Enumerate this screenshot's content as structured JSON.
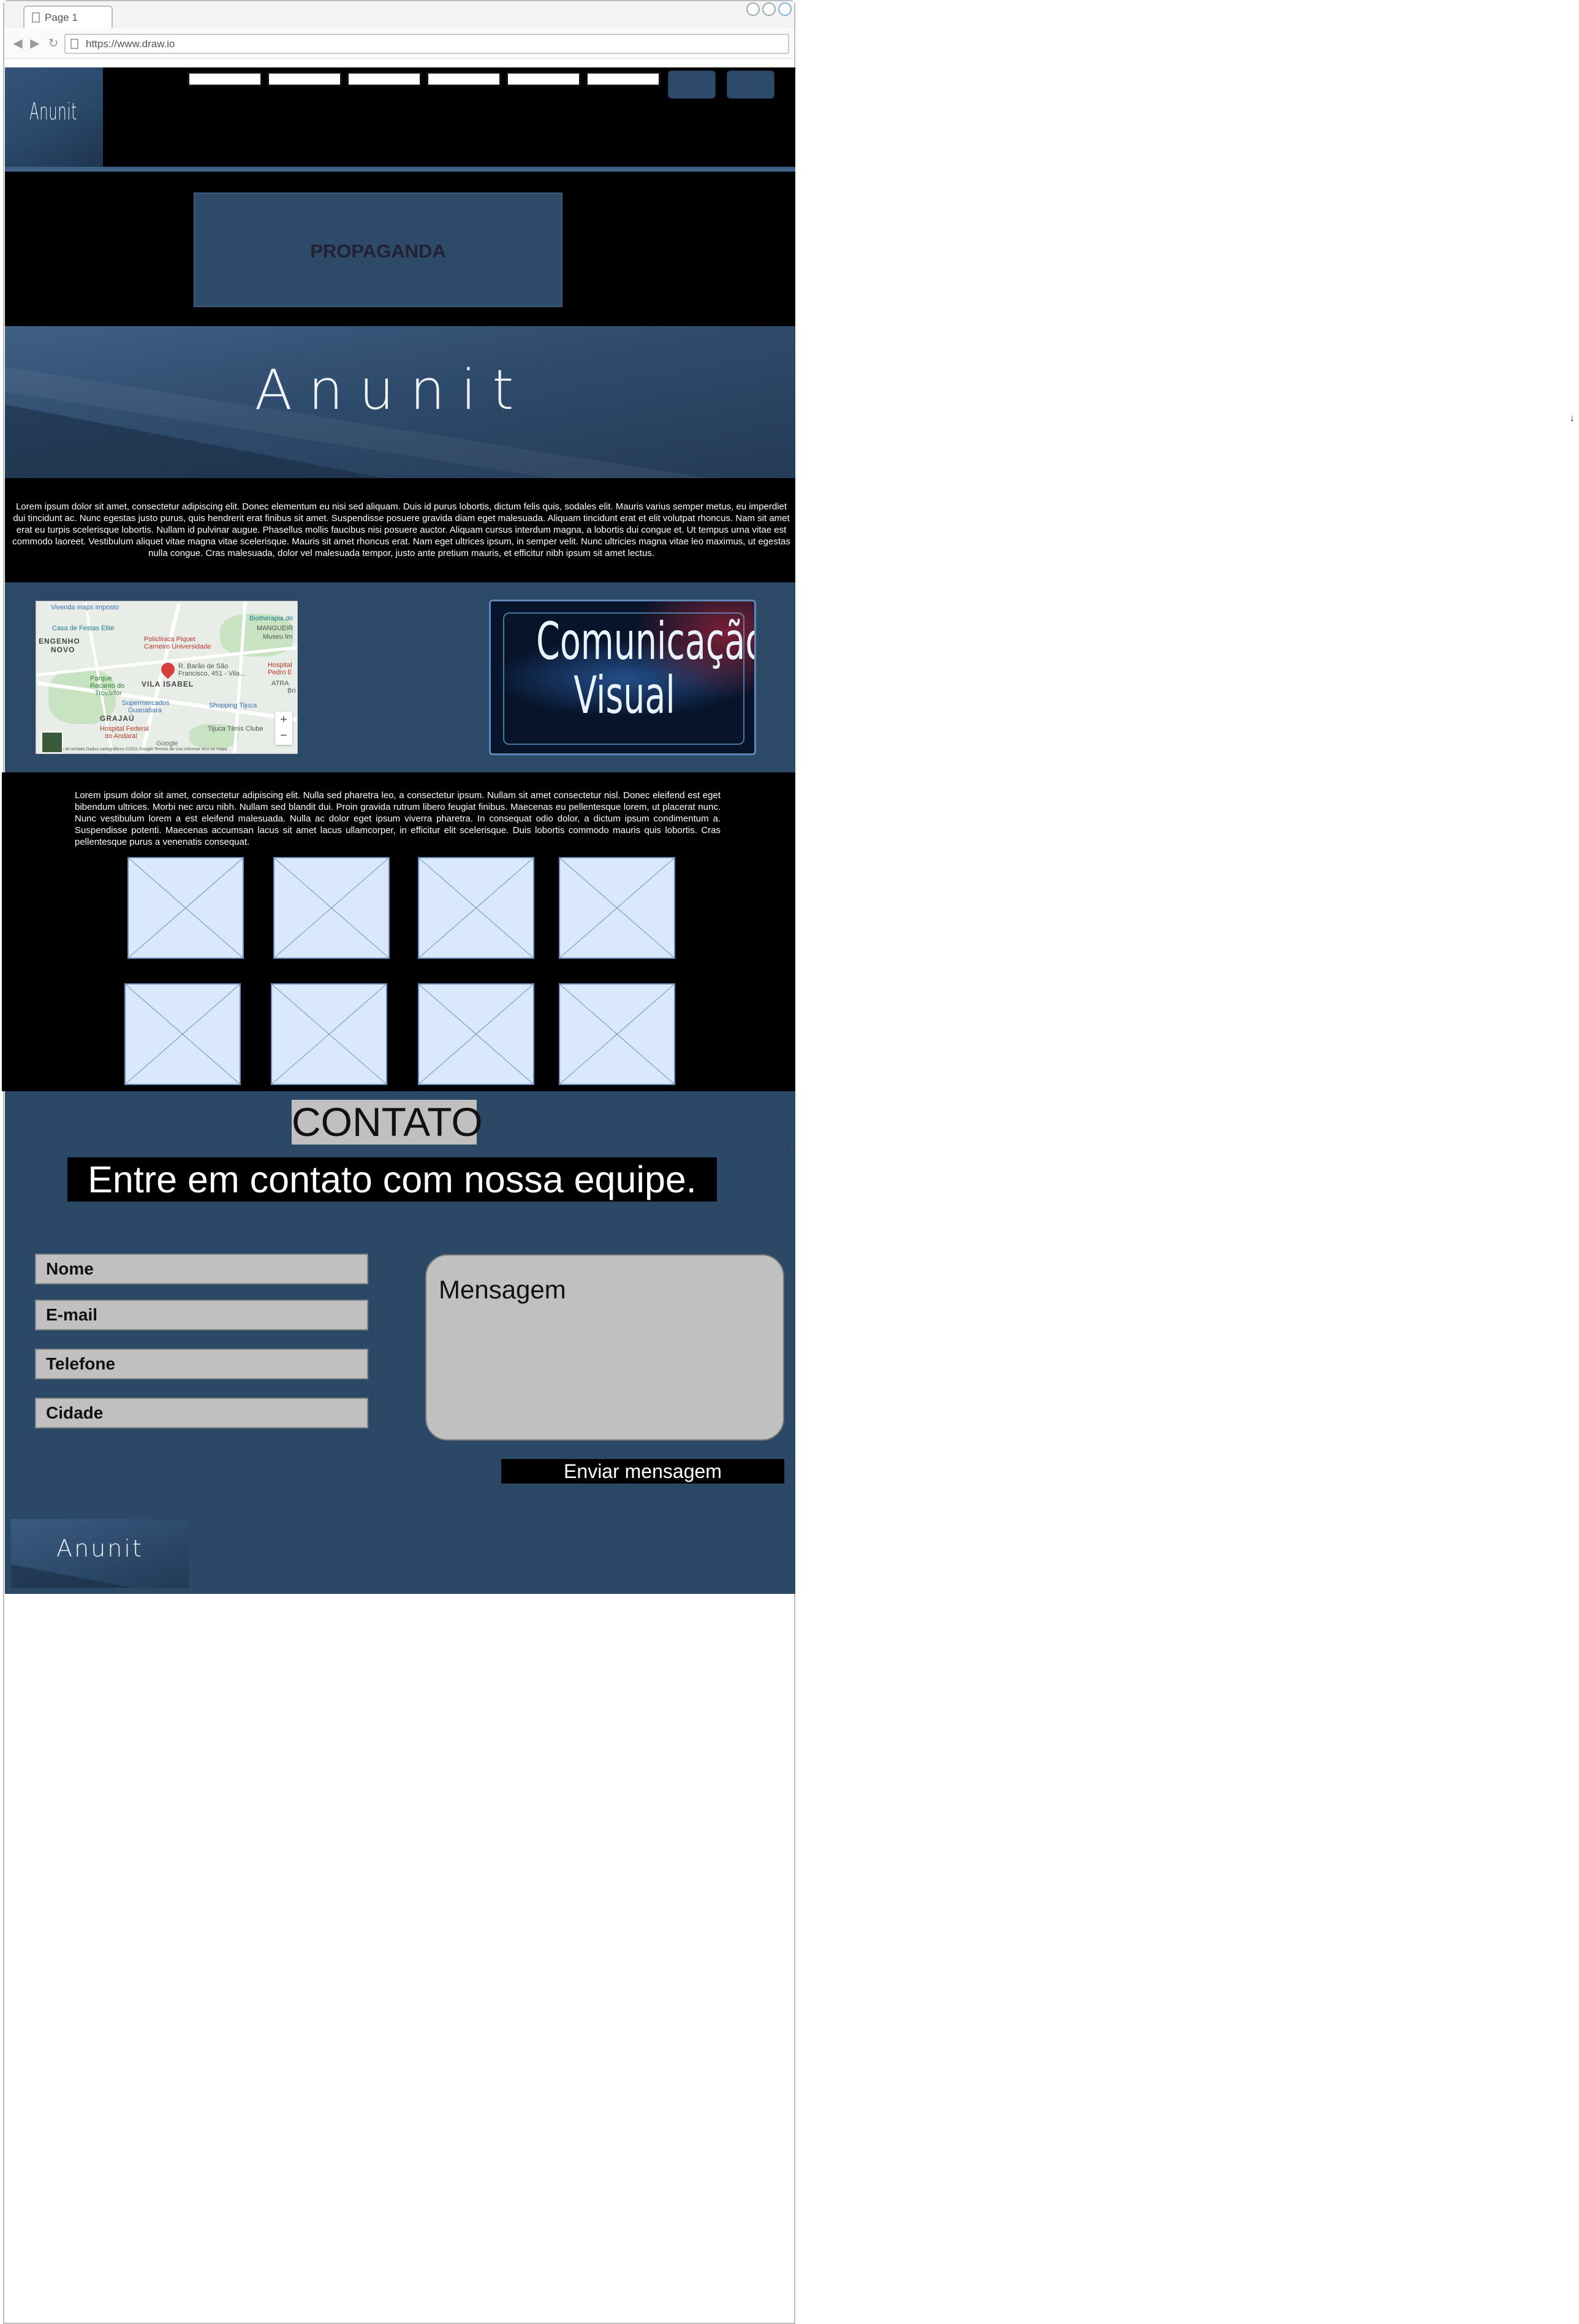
{
  "browser": {
    "tab_label": "Page 1",
    "url": "https://www.draw.io",
    "back_glyph": "◀",
    "forward_glyph": "▶",
    "reload_glyph": "↻"
  },
  "header": {
    "logo": "Anunit",
    "menu_links": [
      "",
      "",
      "",
      "",
      "",
      ""
    ],
    "buttons": [
      "",
      ""
    ]
  },
  "ad": {
    "label": "PROPAGANDA"
  },
  "hero": {
    "title": "Anunit"
  },
  "intro": {
    "text": "Lorem ipsum dolor sit amet, consectetur adipiscing elit. Donec elementum eu nisi sed aliquam. Duis id purus lobortis, dictum felis quis, sodales elit. Mauris varius semper metus, eu imperdiet dui tincidunt ac. Nunc egestas justo purus, quis hendrerit erat finibus sit amet. Suspendisse posuere gravida diam eget malesuada. Aliquam tincidunt erat et elit volutpat rhoncus. Nam sit amet erat eu turpis scelerisque lobortis. Nullam id pulvinar augue. Phasellus mollis faucibus nisi posuere auctor. Aliquam cursus interdum magna, a lobortis dui congue et. Ut tempus urna vitae est commodo laoreet. Vestibulum aliquet vitae magna vitae scelerisque. Mauris sit amet rhoncus erat. Nam eget ultrices ipsum, in semper velit. Nunc ultricies magna vitae leo maximus, ut egestas nulla congue. Cras malesuada, dolor vel malesuada tempor, justo ante pretium mauris, et efficitur nibh ipsum sit amet lectus."
  },
  "map": {
    "labels": [
      "Vivenda maps imposto",
      "Casa de Festas Elite",
      "Biotherapia do",
      "MANGUEIR",
      "Museu Im",
      "ENGENHO",
      "NOVO",
      "Policlínica Piquet",
      "Carneiro Universidade",
      "Hospital",
      "Pedro E",
      "R. Barão de São",
      "Francisco, 451 - Vila...",
      "Parque",
      "Recanto do",
      "Trovador",
      "VILA ISABEL",
      "ATRA",
      "Bri",
      "Supermercados",
      "Guanabara",
      "Shopping Tijuca",
      "GRAJAÚ",
      "Hospital Federal",
      "do Andaraí",
      "Tijuca Tênis Clube",
      "Google",
      "Atalhos do teclado    Dados cartográficos ©2021 Google    Termos de Uso    Informar erro no mapa"
    ],
    "zoom_in": "+",
    "zoom_out": "−"
  },
  "visual": {
    "line1": "Comunicação",
    "line2": "Visual"
  },
  "gallery": {
    "text": "Lorem ipsum dolor sit amet, consectetur adipiscing elit. Nulla sed pharetra leo, a consectetur ipsum. Nullam sit amet consectetur nisl. Donec eleifend est eget bibendum ultrices. Morbi nec arcu nibh. Nullam sed blandit dui. Proin gravida rutrum libero feugiat finibus. Maecenas eu pellentesque lorem, ut placerat nunc. Nunc vestibulum lorem a est eleifend malesuada. Nulla ac dolor eget ipsum viverra pharetra. In consequat odio dolor, a dictum ipsum condimentum a. Suspendisse potenti. Maecenas accumsan lacus sit amet lacus ullamcorper, in efficitur elit scelerisque. Duis lobortis commodo mauris quis lobortis. Cras pellentesque purus a venenatis consequat."
  },
  "contact": {
    "title": "CONTATO",
    "subtitle": "Entre em contato com nossa equipe.",
    "fields": {
      "name": "Nome",
      "email": "E-mail",
      "phone": "Telefone",
      "city": "Cidade"
    },
    "message": "Mensagem",
    "send": "Enviar mensagem"
  },
  "footer": {
    "logo": "Anunit"
  },
  "colors": {
    "navy": "#2c4867",
    "black": "#000000",
    "placeholder_fill": "#dae8fc",
    "placeholder_stroke": "#6c8ebf",
    "field_gray": "#c0c0c0"
  },
  "icons": [
    "page-icon",
    "back-arrow-icon",
    "forward-arrow-icon",
    "reload-icon",
    "window-control-icon",
    "map-pin-icon",
    "image-placeholder-icon",
    "down-arrow-icon"
  ]
}
